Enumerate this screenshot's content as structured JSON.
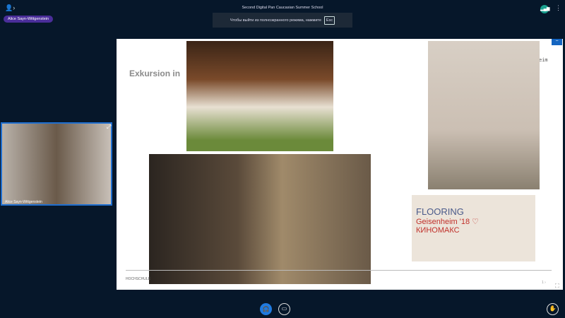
{
  "header": {
    "users_icon": "👤›",
    "presenter_name": "Alice Sayn-Wittgenstein",
    "title": "Second Digital Pan Caucasian Summer School",
    "fullscreen_notice": "Чтобы выйти из полноэкранного режима, нажмите",
    "esc_key": "Esc"
  },
  "slide": {
    "title": "Exkursion in",
    "title_tail": "eim",
    "footer": "HOCHSCHULE",
    "page": "1 ›",
    "photo_text": {
      "line1": "FLOORING",
      "line2": "Geisenheim '18 ♡",
      "line3": "КИНОМАКС"
    }
  },
  "webcam": {
    "name": "Alice Sayn-Wittgenstein"
  },
  "icons": {
    "connection": "signal-icon",
    "menu": "⋮",
    "minimize": "−",
    "expand": "⤢",
    "audio": "🎧",
    "video": "▭",
    "raise": "✋",
    "fit": "⛶"
  }
}
